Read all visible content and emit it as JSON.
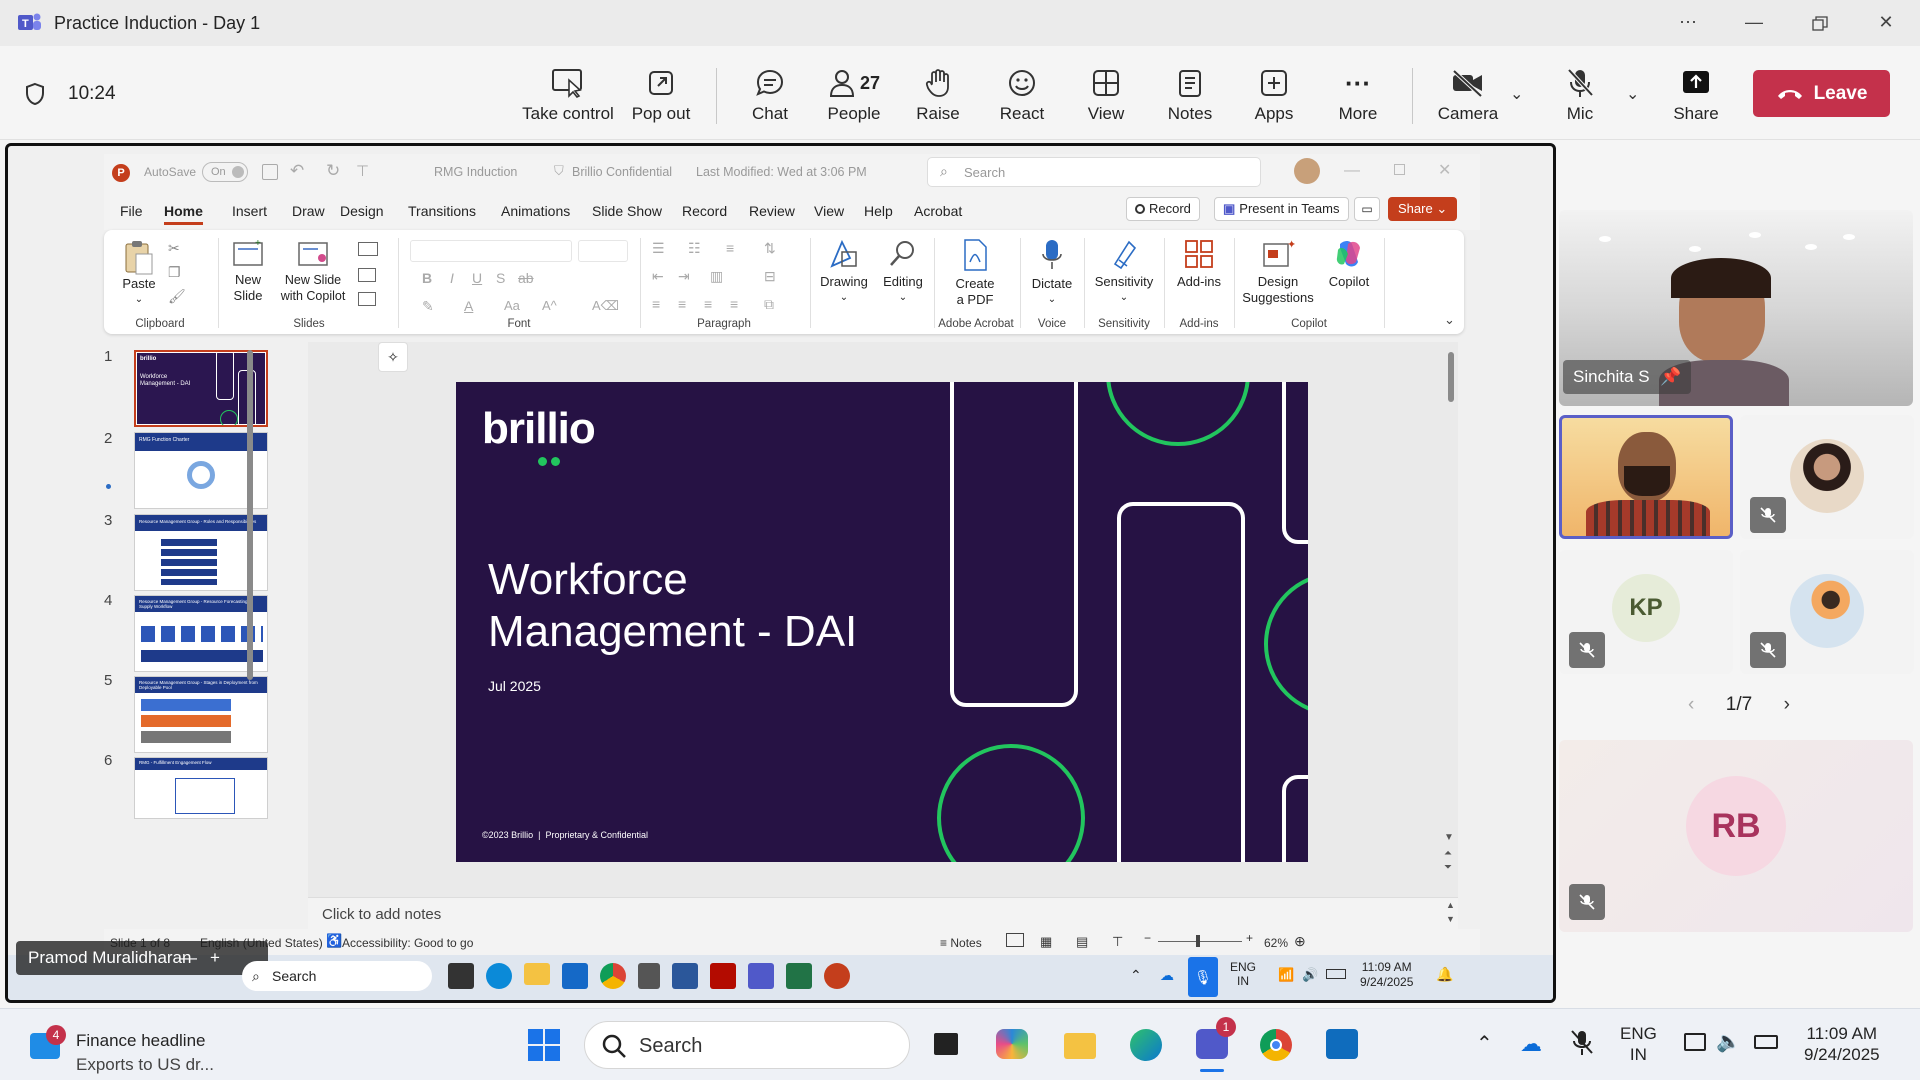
{
  "window": {
    "title": "Practice Induction - Day 1"
  },
  "meeting": {
    "timer": "10:24",
    "buttons": {
      "take_control": "Take control",
      "pop_out": "Pop out",
      "chat": "Chat",
      "people": "People",
      "people_count": "27",
      "raise": "Raise",
      "react": "React",
      "view": "View",
      "notes": "Notes",
      "apps": "Apps",
      "more": "More",
      "camera": "Camera",
      "mic": "Mic",
      "share": "Share",
      "leave": "Leave"
    },
    "presenter_label": "Pramod Muralidharan"
  },
  "powerpoint": {
    "autosave": "AutoSave",
    "autosave_state": "On",
    "doc_title": "RMG Induction",
    "sensitivity": "Brillio Confidential",
    "modified": "Last Modified: Wed at 3:06 PM",
    "search_placeholder": "Search",
    "tabs": [
      "File",
      "Home",
      "Insert",
      "Draw",
      "Design",
      "Transitions",
      "Animations",
      "Slide Show",
      "Record",
      "Review",
      "View",
      "Help",
      "Acrobat"
    ],
    "record_btn": "Record",
    "present_btn": "Present in Teams",
    "share_btn": "Share",
    "ribbon": {
      "paste": "Paste",
      "clipboard": "Clipboard",
      "new_slide": "New Slide",
      "new_slide_copilot": "New Slide with Copilot",
      "slides": "Slides",
      "font": "Font",
      "paragraph": "Paragraph",
      "drawing": "Drawing",
      "editing": "Editing",
      "create_pdf": "Create a PDF",
      "adobe_acrobat": "Adobe Acrobat",
      "dictate": "Dictate",
      "voice": "Voice",
      "sensitivity_btn": "Sensitivity",
      "sensitivity_grp": "Sensitivity",
      "addins_btn": "Add-ins",
      "addins_grp": "Add-ins",
      "design_suggestions": "Design Suggestions",
      "copilot_btn": "Copilot",
      "copilot_grp": "Copilot"
    },
    "thumbnails": [
      {
        "num": "1",
        "caption": "Workforce Management - DAI"
      },
      {
        "num": "2",
        "caption": "RMG Function Charter"
      },
      {
        "num": "3",
        "caption": "Resource Management Group - Roles and Responsibilities"
      },
      {
        "num": "4",
        "caption": "Resource Management Group - Resource Forecasting & Supply Workflow"
      },
      {
        "num": "5",
        "caption": "Resource Management Group - Stages in Deployment from Deployable Pool"
      },
      {
        "num": "6",
        "caption": "RMG - Fulfillment Engagement Flow"
      }
    ],
    "slide": {
      "logo": "brillio",
      "title_line1": "Workforce",
      "title_line2": "Management - DAI",
      "date": "Jul 2025",
      "footer": "©2023 Brillio  |  Proprietary & Confidential"
    },
    "notes_placeholder": "Click to add notes",
    "status": {
      "slide_of": "Slide 1 of 8",
      "language": "English (United States)",
      "accessibility": "Accessibility: Good to go",
      "notes": "Notes",
      "zoom": "62%"
    }
  },
  "remote_taskbar": {
    "search": "Search",
    "lang1": "ENG",
    "lang2": "IN",
    "time": "11:09 AM",
    "date": "9/24/2025"
  },
  "participants": {
    "pinned_name": "Sinchita S",
    "kp_initials": "KP",
    "rb_initials": "RB",
    "pager": "1/7"
  },
  "taskbar": {
    "news_badge": "4",
    "news_title": "Finance headline",
    "news_sub": "Exports to US dr...",
    "search": "Search",
    "teams_badge": "1",
    "lang1": "ENG",
    "lang2": "IN",
    "time": "11:09 AM",
    "date": "9/24/2025"
  }
}
